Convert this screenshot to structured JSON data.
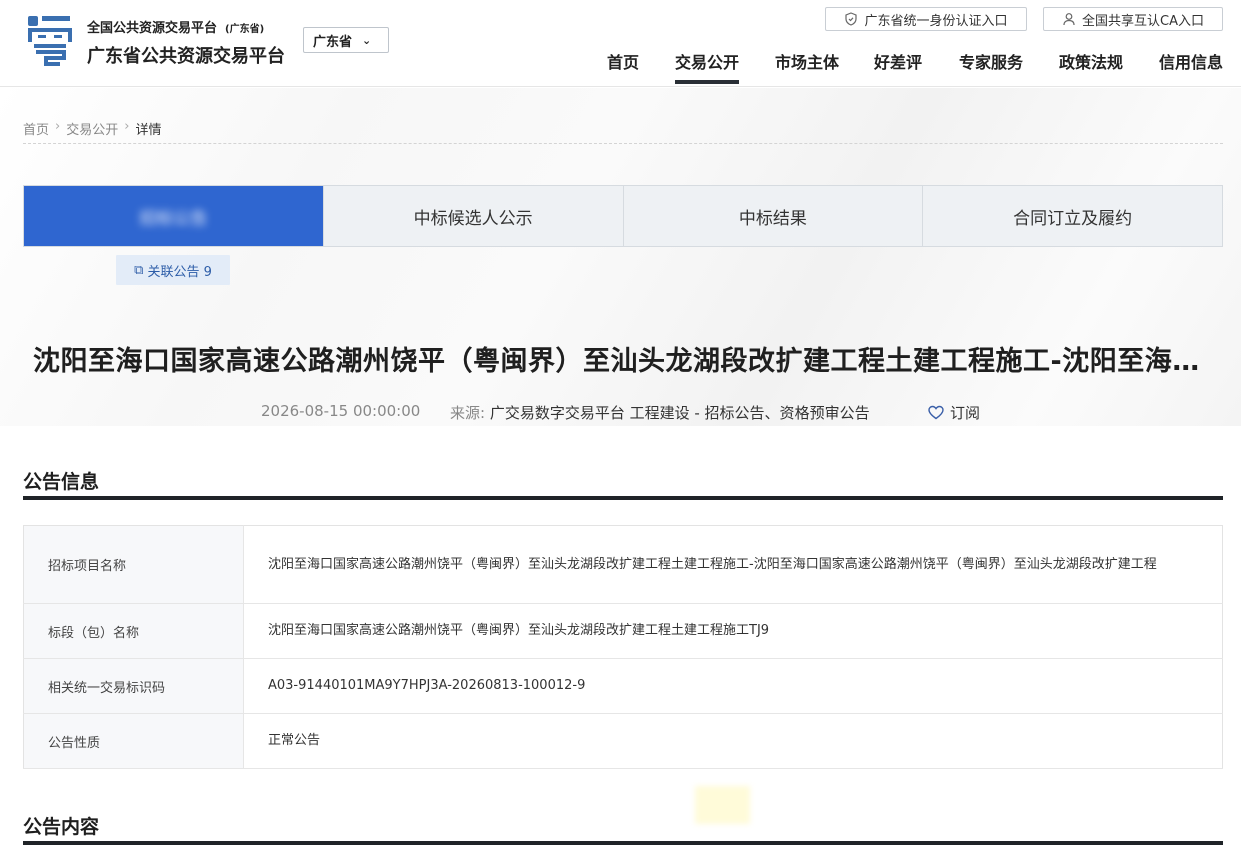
{
  "header": {
    "brand_top": "全国公共资源交易平台",
    "brand_top_note": "(广东省)",
    "brand_main": "广东省公共资源交易平台",
    "province": "广东省",
    "top_buttons": [
      {
        "label": "广东省统一身份认证入口",
        "icon": "shield-icon"
      },
      {
        "label": "全国共享互认CA入口",
        "icon": "user-icon"
      }
    ],
    "nav": [
      "首页",
      "交易公开",
      "市场主体",
      "好差评",
      "专家服务",
      "政策法规",
      "信用信息"
    ],
    "nav_active": "交易公开"
  },
  "breadcrumb": [
    "首页",
    "交易公开",
    "详情"
  ],
  "stages": [
    "招标公告",
    "中标候选人公示",
    "中标结果",
    "合同订立及履约"
  ],
  "related": {
    "label": "关联公告 9"
  },
  "title": "沈阳至海口国家高速公路潮州饶平（粤闽界）至汕头龙湖段改扩建工程土建工程施工-沈阳至海口国家高速公路潮州饶平（粤闽界）至汕头龙湖段改扩建工程",
  "meta": {
    "date": "2026-08-15 00:00:00",
    "source_label": "来源:",
    "source": "广交易数字交易平台 工程建设 - 招标公告、资格预审公告",
    "subscribe": "订阅"
  },
  "section_info": "公告信息",
  "info_rows": [
    {
      "key": "招标项目名称",
      "value": "沈阳至海口国家高速公路潮州饶平（粤闽界）至汕头龙湖段改扩建工程土建工程施工-沈阳至海口国家高速公路潮州饶平（粤闽界）至汕头龙湖段改扩建工程"
    },
    {
      "key": "标段（包）名称",
      "value": "沈阳至海口国家高速公路潮州饶平（粤闽界）至汕头龙湖段改扩建工程土建工程施工TJ9"
    },
    {
      "key": "相关统一交易标识码",
      "value": "A03-91440101MA9Y7HPJ3A-20260813-100012-9"
    },
    {
      "key": "公告性质",
      "value": "正常公告"
    }
  ],
  "section_content": "公告内容",
  "colors": {
    "accent": "#2f66d0",
    "nav_underline": "#2a2f36",
    "related_bg": "#e3ecf8",
    "logo": "#3a6fb0"
  }
}
